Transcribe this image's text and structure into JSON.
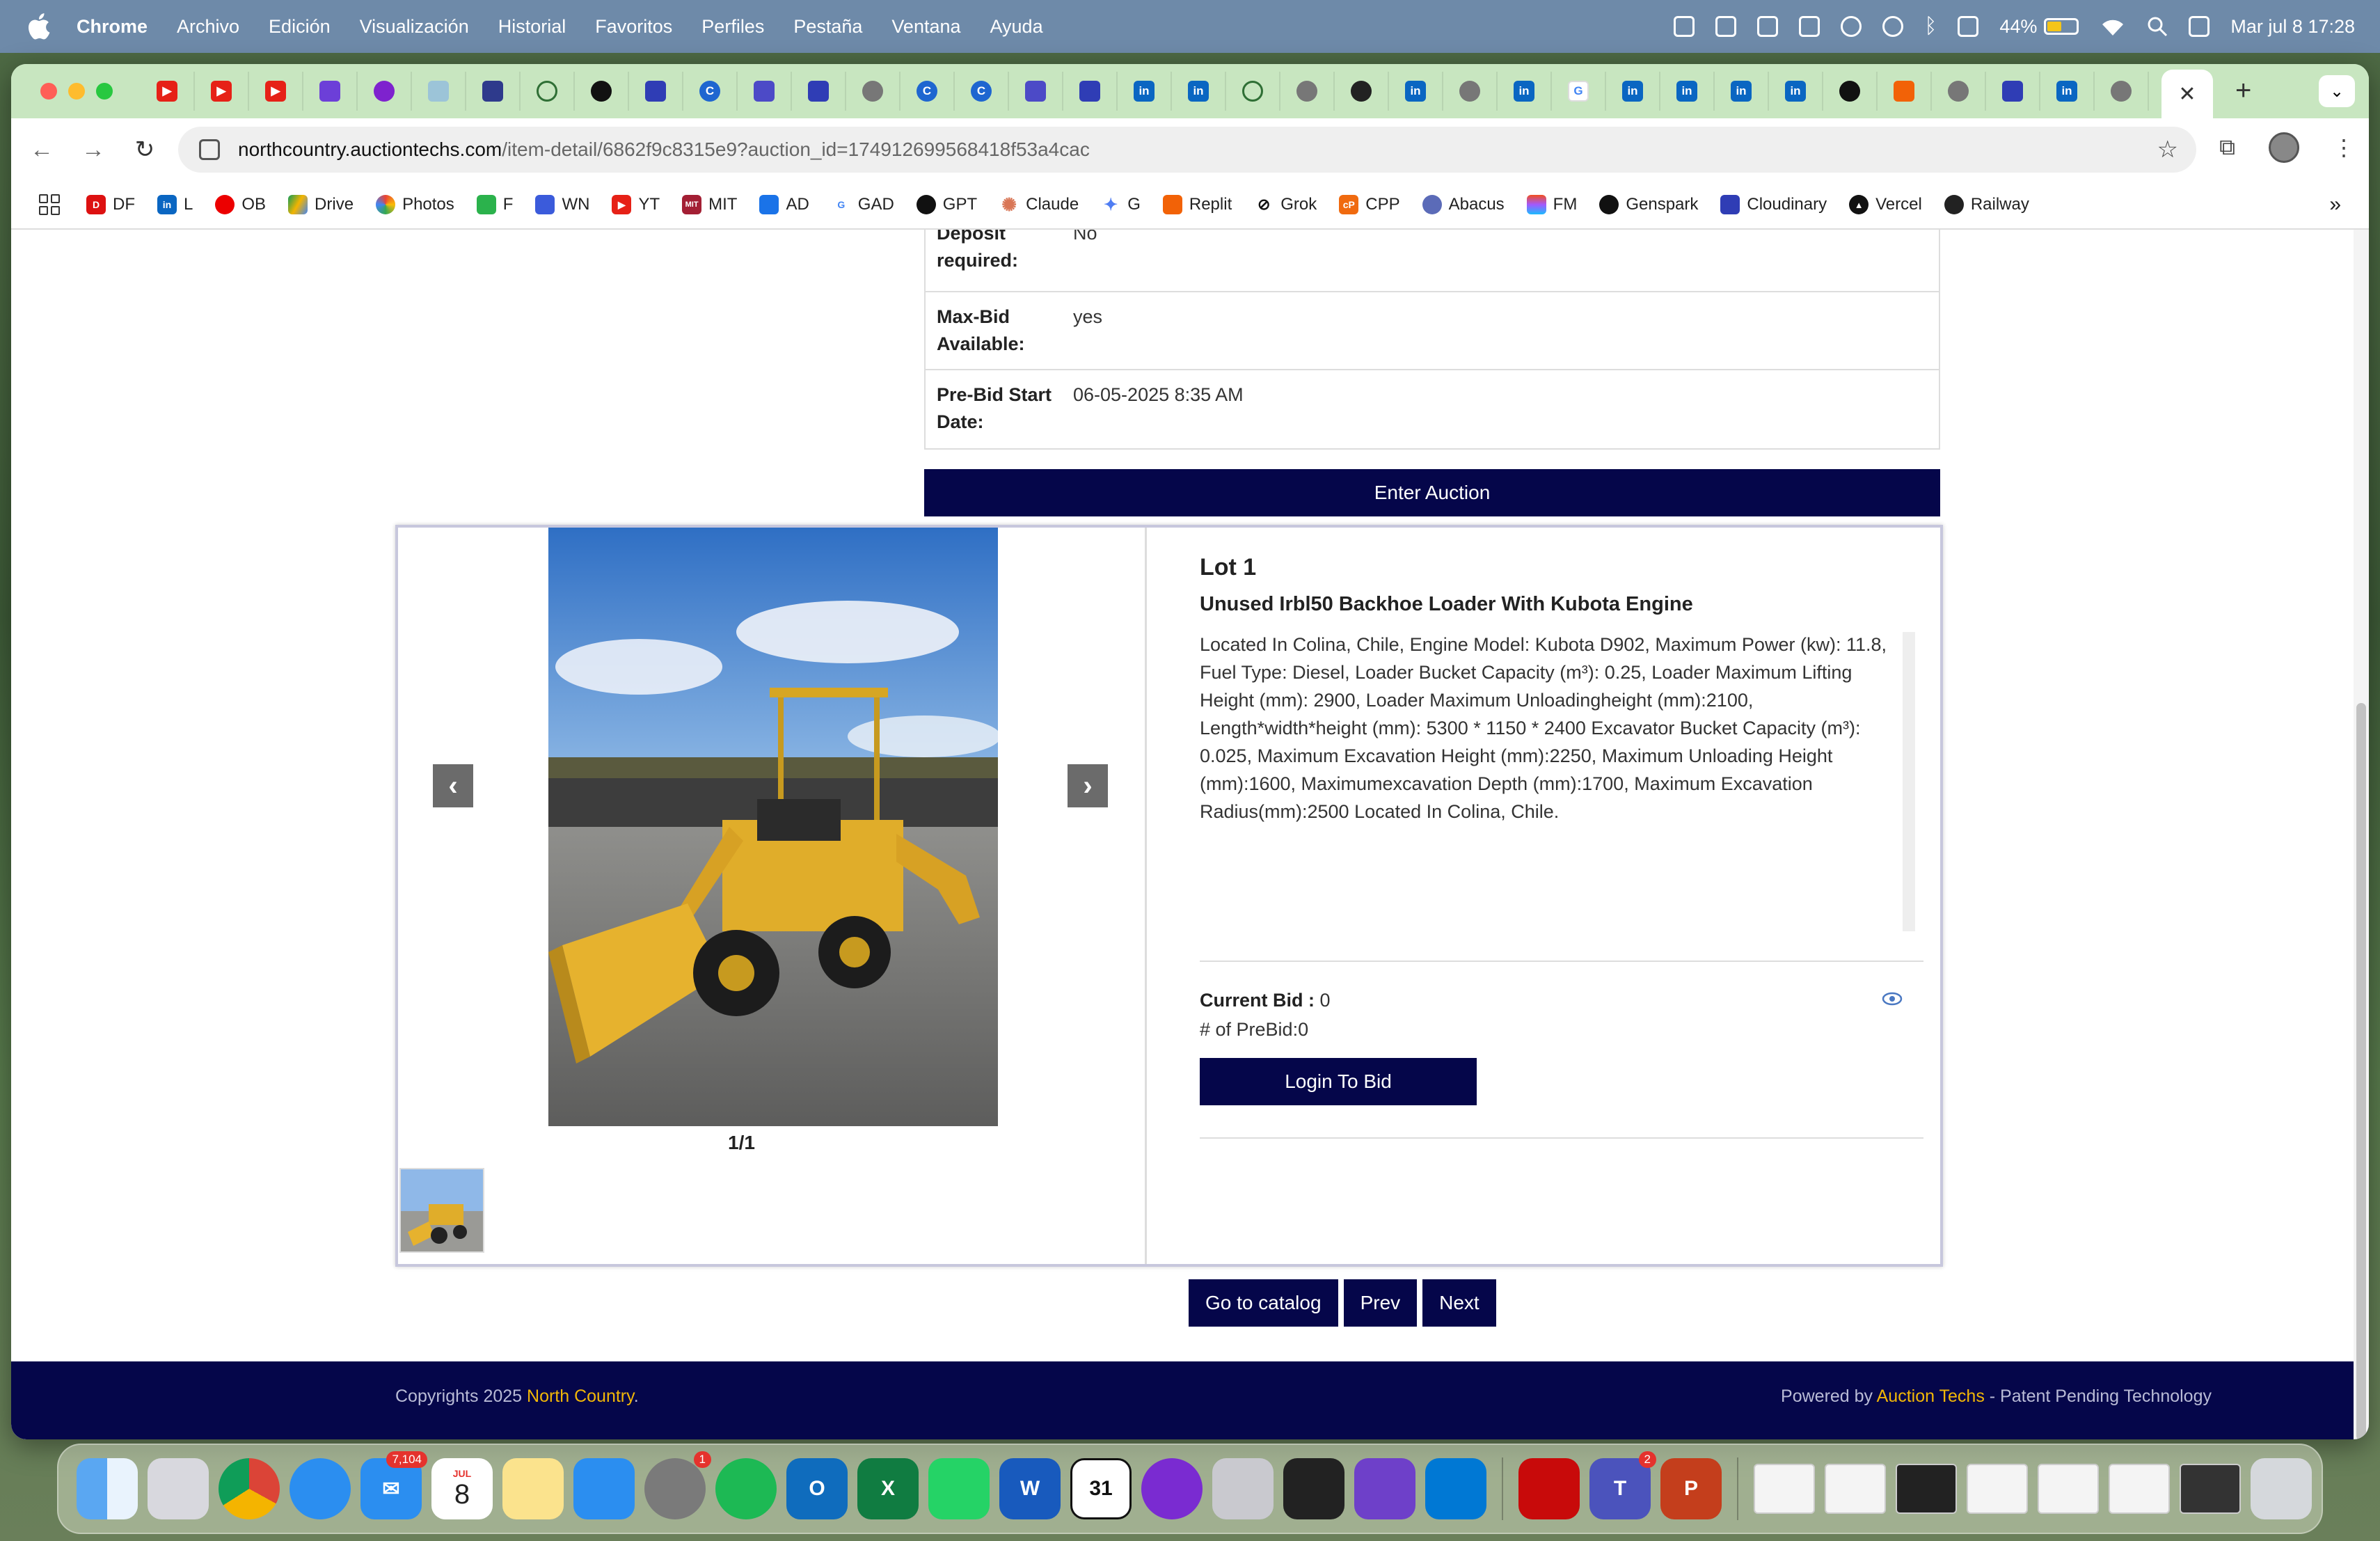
{
  "menubar": {
    "app": "Chrome",
    "items": [
      "Archivo",
      "Edición",
      "Visualización",
      "Historial",
      "Favoritos",
      "Perfiles",
      "Pestaña",
      "Ventana",
      "Ayuda"
    ],
    "battery": "44%",
    "battery_level": 0.44,
    "datetime": "Mar jul 8  17:28"
  },
  "browser": {
    "url_host": "northcountry.auctiontechs.com",
    "url_path": "/item-detail/6862f9c8315e9?auction_id=174912699568418f53a4cac",
    "bookmarks": [
      "DF",
      "L",
      "OB",
      "Drive",
      "Photos",
      "F",
      "WN",
      "YT",
      "MIT",
      "AD",
      "GAD",
      "GPT",
      "Claude",
      "G",
      "Replit",
      "Grok",
      "CPP",
      "Abacus",
      "FM",
      "Genspark",
      "Cloudinary",
      "Vercel",
      "Railway"
    ]
  },
  "details": {
    "deposit_label": "Deposit required:",
    "deposit_value": "No",
    "maxbid_label": "Max-Bid Available:",
    "maxbid_value": "yes",
    "prebid_label": "Pre-Bid Start Date:",
    "prebid_value": "06-05-2025 8:35 AM"
  },
  "enter_auction": "Enter Auction",
  "lot": {
    "number": "Lot 1",
    "title": "Unused Irbl50 Backhoe Loader With Kubota Engine",
    "description": "Located In Colina, Chile, Engine Model: Kubota D902, Maximum Power (kw): 11.8, Fuel Type: Diesel, Loader Bucket Capacity (m³): 0.25, Loader Maximum Lifting Height (mm): 2900, Loader Maximum Unloadingheight (mm):2100, Length*width*height (mm): 5300 * 1150 * 2400 Excavator Bucket Capacity (m³): 0.025, Maximum Excavation Height (mm):2250, Maximum Unloading Height (mm):1600, Maximumexcavation Depth (mm):1700, Maximum Excavation Radius(mm):2500 Located In Colina, Chile.",
    "current_bid_label": "Current Bid :",
    "current_bid_value": "0",
    "prebid_count": "# of PreBid:0",
    "login_button": "Login To Bid",
    "photo_counter": "1/1"
  },
  "nav": {
    "catalog": "Go to catalog",
    "prev": "Prev",
    "next": "Next"
  },
  "footer": {
    "copyright_prefix": "Copyrights 2025 ",
    "company": "North Country",
    "copyright_suffix": ".",
    "powered_prefix": "Powered by ",
    "powered_company": "Auction Techs",
    "powered_suffix": " - Patent Pending Technology"
  },
  "dock": {
    "mail_badge": "7,104",
    "calendar_month": "JUL",
    "calendar_day": "8",
    "settings_badge": "1",
    "teams_badge": "2",
    "calendar_app_day": "31"
  }
}
